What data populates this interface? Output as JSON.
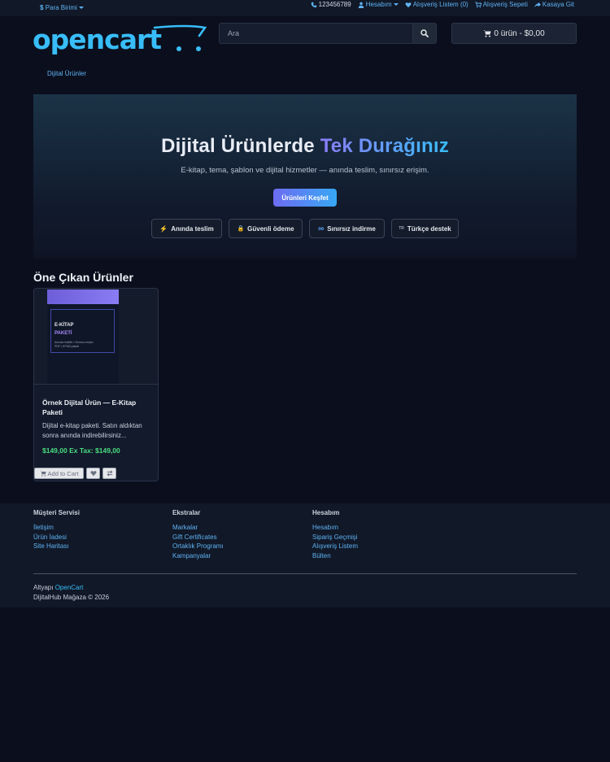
{
  "topbar": {
    "currency_symbol": "$",
    "currency_label": "Para Birimi",
    "phone": "123456789",
    "account": "Hesabım",
    "wishlist": "Alışveriş Listem (0)",
    "cart": "Alışveriş Sepeti",
    "checkout": "Kasaya Git"
  },
  "logo": {
    "text": "opencart"
  },
  "search": {
    "placeholder": "Ara"
  },
  "cart_button": {
    "label": "0 ürün - $0,00"
  },
  "breadcrumb": {
    "current": "Dijital Ürünler"
  },
  "hero": {
    "title_main": "Dijital Ürünlerde ",
    "title_highlight": "Tek Durağınız",
    "subtitle": "E-kitap, tema, şablon ve dijital hizmetler — anında teslim, sınırsız erişim.",
    "cta": "Ürünleri Keşfet",
    "badges": [
      {
        "icon": "⚡",
        "label": "Anında teslim"
      },
      {
        "icon": "🔒",
        "label": "Güvenli ödeme"
      },
      {
        "icon": "∞",
        "label": "Sınırsız indirme"
      },
      {
        "icon": "TR",
        "label": "Türkçe destek"
      }
    ]
  },
  "featured": {
    "title": "Öne Çıkan Ürünler",
    "product": {
      "image_title": "E-KİTAP",
      "image_subtitle": "PAKETİ",
      "image_line1": "Anında indirilir • Sınırsız erişim",
      "image_line2": "PDF • EPUB paketi",
      "name": "Örnek Dijital Ürün — E-Kitap Paketi",
      "description": "Dijital e-kitap paketi. Satın aldıktan sonra anında indirebilirsiniz...",
      "price": "$149,00 Ex Tax: $149,00",
      "add_to_cart": "Add to Cart"
    }
  },
  "footer": {
    "columns": [
      {
        "title": "Müşteri Servisi",
        "links": [
          "İletişim",
          "Ürün İadesi",
          "Site Haritası"
        ]
      },
      {
        "title": "Ekstralar",
        "links": [
          "Markalar",
          "Gift Certificates",
          "Ortaklık Programı",
          "Kampanyalar"
        ]
      },
      {
        "title": "Hesabım",
        "links": [
          "Hesabım",
          "Sipariş Geçmişi",
          "Alışveriş Listem",
          "Bülten"
        ]
      }
    ],
    "powered_prefix": "Altyapı",
    "powered_link": "OpenCart",
    "copyright": "DijitalHub Mağaza © 2026"
  },
  "colors": {
    "background": "#0b0f1d",
    "accent": "#38bdf8",
    "price": "#4ade80",
    "highlight": "#7c8cf8"
  }
}
